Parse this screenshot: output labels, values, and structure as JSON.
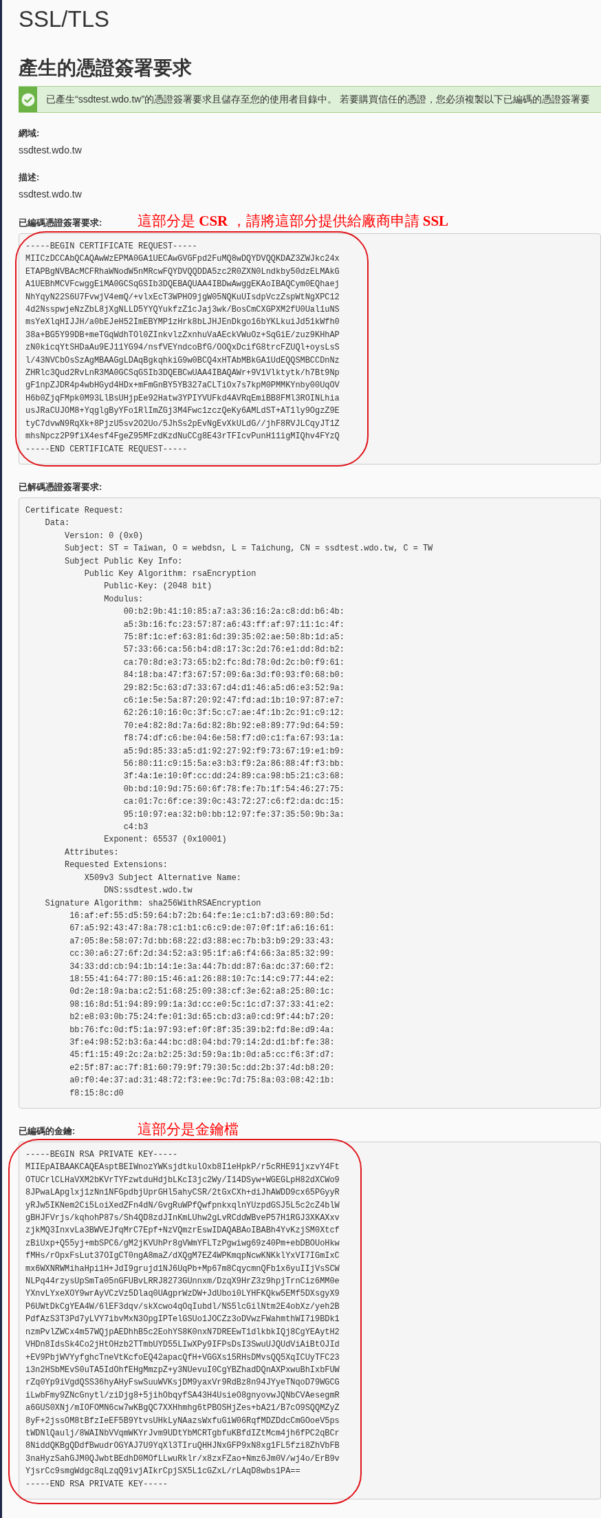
{
  "page_title": "SSL/TLS",
  "heading": "產生的憑證簽署要求",
  "alert": {
    "kind": "success",
    "text": "已產生“ssdtest.wdo.tw”的憑證簽署要求且儲存至您的使用者目錄中。 若要購買信任的憑證，您必須複製以下已編碼的憑證簽署要"
  },
  "fields": [
    {
      "label": "網域:",
      "value": "ssdtest.wdo.tw"
    },
    {
      "label": "描述:",
      "value": "ssdtest.wdo.tw"
    }
  ],
  "blocks": [
    {
      "label": "已編碼憑證簽署要求:",
      "annotation": "這部分是 **CSR** ，請將這部分提供給廠商申請 **SSL**",
      "circled": true,
      "text": "-----BEGIN CERTIFICATE REQUEST-----\nMIICzDCCAbQCAQAwWzEPMA0GA1UECAwGVGFpd2FuMQ8wDQYDVQQKDAZ3ZWJkc24x\nETAPBgNVBAcMCFRhaWNodW5nMRcwFQYDVQQDDA5zc2R0ZXN0Lndkby50dzELMAkG\nA1UEBhMCVFcwggEiMA0GCSqGSIb3DQEBAQUAA4IBDwAwggEKAoIBAQCym0EQhaej\nNhYqyN22S6U7FvwjV4emQ/+vlxEcT3WPHO9jgW05NQKuUIsdpVczZspWtNgXPC12\n4d2NsspwjeNzZbL8jXgNLLD5YYQYukfzZ1cJaj3wk/BosCmCXGPXM2fU0Ual1uNS\nmsYeXlqHIJJH/a0bEJeH52ImEBYMP1zHrk8bLJHJEnDkgo16bYKLkuiJd51kWfh0\n38a+BG5Y99DB+meTGqWdhTOl0ZInkvlzZxnhuVaAEckVWuOz+SqGiE/zuz9KHhAP\nzN0kicqYtSHDaAu9EJ11YG94/nsfVEYndcoBfG/OOQxDcifG8trcFZUQl+oysLsS\nl/43NVCbOsSzAgMBAAGgLDAqBgkqhkiG9w0BCQ4xHTAbMBkGA1UdEQQSMBCCDnNz\nZHRlc3Qud2RvLnR3MA0GCSqGSIb3DQEBCwUAA4IBAQAWr+9V1Vlktytk/h7Bt9Np\ngF1npZJDR4p4wbHGyd4HDx+mFmGnBY5YB327aCLTiOx7s7kpM0PMMKYnby00UqOV\nH6b0ZjqFMpk0M93LlBsUHjpEe92Hatw3YPIYVUFkd4AVRqEmiBB8FMl3ROINLhia\nusJRaCUJOM8+YqglgByYFo1RlImZGj3M4Fwc1zczQeKy6AMLdST+AT1ly9OgzZ9E\ntyC7dvwN9RqXk+8PjzU5sv2O2Uo/5JhSs2pEvNgEvXkULdG//jhF8RVJLCqyJT1Z\nmhsNpcz2P9fiX4esf4FgeZ95MFzdKzdNuCCg8E43rTFIcvPunH11igMIQhv4FYzQ\n-----END CERTIFICATE REQUEST-----"
    },
    {
      "label": "已解碼憑證簽署要求:",
      "circled": false,
      "text": "Certificate Request:\n    Data:\n        Version: 0 (0x0)\n        Subject: ST = Taiwan, O = webdsn, L = Taichung, CN = ssdtest.wdo.tw, C = TW\n        Subject Public Key Info:\n            Public Key Algorithm: rsaEncryption\n                Public-Key: (2048 bit)\n                Modulus:\n                    00:b2:9b:41:10:85:a7:a3:36:16:2a:c8:dd:b6:4b:\n                    a5:3b:16:fc:23:57:87:a6:43:ff:af:97:11:1c:4f:\n                    75:8f:1c:ef:63:81:6d:39:35:02:ae:50:8b:1d:a5:\n                    57:33:66:ca:56:b4:d8:17:3c:2d:76:e1:dd:8d:b2:\n                    ca:70:8d:e3:73:65:b2:fc:8d:78:0d:2c:b0:f9:61:\n                    84:18:ba:47:f3:67:57:09:6a:3d:f0:93:f0:68:b0:\n                    29:82:5c:63:d7:33:67:d4:d1:46:a5:d6:e3:52:9a:\n                    c6:1e:5e:5a:87:20:92:47:fd:ad:1b:10:97:87:e7:\n                    62:26:10:16:0c:3f:5c:c7:ae:4f:1b:2c:91:c9:12:\n                    70:e4:82:8d:7a:6d:82:8b:92:e8:89:77:9d:64:59:\n                    f8:74:df:c6:be:04:6e:58:f7:d0:c1:fa:67:93:1a:\n                    a5:9d:85:33:a5:d1:92:27:92:f9:73:67:19:e1:b9:\n                    56:80:11:c9:15:5a:e3:b3:f9:2a:86:88:4f:f3:bb:\n                    3f:4a:1e:10:0f:cc:dd:24:89:ca:98:b5:21:c3:68:\n                    0b:bd:10:9d:75:60:6f:78:fe:7b:1f:54:46:27:75:\n                    ca:01:7c:6f:ce:39:0c:43:72:27:c6:f2:da:dc:15:\n                    95:10:97:ea:32:b0:bb:12:97:fe:37:35:50:9b:3a:\n                    c4:b3\n                Exponent: 65537 (0x10001)\n        Attributes:\n        Requested Extensions:\n            X509v3 Subject Alternative Name:\n                DNS:ssdtest.wdo.tw\n    Signature Algorithm: sha256WithRSAEncryption\n         16:af:ef:55:d5:59:64:b7:2b:64:fe:1e:c1:b7:d3:69:80:5d:\n         67:a5:92:43:47:8a:78:c1:b1:c6:c9:de:07:0f:1f:a6:16:61:\n         a7:05:8e:58:07:7d:bb:68:22:d3:88:ec:7b:b3:b9:29:33:43:\n         cc:30:a6:27:6f:2d:34:52:a3:95:1f:a6:f4:66:3a:85:32:99:\n         34:33:dd:cb:94:1b:14:1e:3a:44:7b:dd:87:6a:dc:37:60:f2:\n         18:55:41:64:77:80:15:46:a1:26:88:10:7c:14:c9:77:44:e2:\n         0d:2e:18:9a:ba:c2:51:68:25:09:38:cf:3e:62:a8:25:80:1c:\n         98:16:8d:51:94:89:99:1a:3d:cc:e0:5c:1c:d7:37:33:41:e2:\n         b2:e8:03:0b:75:24:fe:01:3d:65:cb:d3:a0:cd:9f:44:b7:20:\n         bb:76:fc:0d:f5:1a:97:93:ef:0f:8f:35:39:b2:fd:8e:d9:4a:\n         3f:e4:98:52:b3:6a:44:bc:d8:04:bd:79:14:2d:d1:bf:fe:38:\n         45:f1:15:49:2c:2a:b2:25:3d:59:9a:1b:0d:a5:cc:f6:3f:d7:\n         e2:5f:87:ac:7f:81:60:79:9f:79:30:5c:dd:2b:37:4d:b8:20:\n         a0:f0:4e:37:ad:31:48:72:f3:ee:9c:7d:75:8a:03:08:42:1b:\n         f8:15:8c:d0"
    },
    {
      "label": "已編碼的金鑰:",
      "annotation": "這部分是金鑰檔",
      "circled": true,
      "text": "-----BEGIN RSA PRIVATE KEY-----\nMIIEpAIBAAKCAQEAsptBEIWnozYWKsjdtkulOxb8I1eHpkP/r5cRHE91jxzvY4Ft\nOTUCrlCLHaVXM2bKVrTYFzwtduHdjbLKcI3jc2Wy/I14DSyw+WGEGLpH82dXCWo9\n8JPwaLApglxj1zNn1NFGpdbjUprGHl5ahyCSR/2tGxCXh+diJhAWDD9cx65PGyyR\nyRJw5IKNem2Ci5LoiXedZFn4dN/GvgRuWPfQwfpnkxqlnYUzpdGSJ5L5c2cZ4blW\ngBHJFVrjs/kqhohP87s/Sh4QD8zdJInKmLUhw2gLvRCddWBveP57H1RGJ3XKAXxv\nzjkMQ3InxvLa3BWVEJfqMrC7Epf+NzVQmzrEswIDAQABAoIBABh4YvKzjSM0Xtcf\nzBiUxp+Q55yj+mbSPC6/gM2jKVUhPr8gVWmYFLTzPgwiwg69z40Pm+ebDBOUoHkw\nfMHs/rOpxFsLut37OIgCT0ngA8maZ/dXQgM7EZ4WPKmqpNcwKNKklYxVI7IGmIxC\nmx6WXNRWMihaHpi1H+JdI9grujd1NJ6UqPb+Mp67m8CqycmnQFb1x6yuIIjVsSCW\nNLPq44rzysUpSmTa05nGFUBvLRRJ8273GUnnxm/DzqX9HrZ3z9hpjTrnCiz6MM0e\nYXnvLYxeXOY9wrAyVCzVz5Dlaq0UAgprWzDW+JdUboi0LYHFKQkw5EMf5DXsgyX9\nP6UWtDkCgYEA4W/6lEF3dqv/skXcwo4qOqIubdl/NS5lcGilNtm2E4obXz/yeh2B\nPdfAzS3T3Pd7yLVY7ibvMxN3OpgIPTelGSUo1JOCZz3oDVwzFWahmthWI7i9BDk1\nnzmPvlZWCx4m57WQjpAEDhhB5c2EohYS8K0nxN7DREEwT1dlkbkIQj8CgYEAytH2\nVHDn8IdsSk4Co2jHtOHzb2TTmbUYD55LIwXPy9IFPsDsI3SwuUJQUdViAiBtOJId\n+EV9PbjWVYyfghcTneVtKcfoEQ42apacQfH+VGGXs15RHsDMvsQQ5XqICUyTFC23\ni3n2HSbMEvS0uTA5IdOhfEHgMmzpZ+y3NUevuI0CgYBZhadDQnAXPxwuBhIxbFUW\nrZq0Yp9iVgdQSS36hyAHyFswSuuWVKsjDM9yaxVr9RdBz8n94JYyeTNqoD79WGCG\niLwbFmy9ZNcGnytl/ziDjg8+5jihObqyfSA43H4UsieO8gnyovwJQNbCVAesegmR\na6GUS0XNj/mIOFOMN6cw7wKBgQC7XXHhmhg6tPBOSHjZes+bA21/B7cO9SQQMZyZ\n8yF+2jssOM8tBfzIeEF5B9YtvsUHkLyNAazsWxfuGiW06RqfMDZDdcCmGOoeV5ps\ntWDNlQaulj/8WAINbVVqmWKYrJvm9UDtYbMCRTgbfuKBfdIZtMcm4jh6fPC2qBCr\n8NiddQKBgQDdfBwudrOGYAJ7U9YqXl3TIruQHHJNxGFP9xN8xg1FL5fzi8ZhVbFB\n3naHyzSahGJM0QJwbtBEdhD0MOfLLwuRklr/x8zxFZao+Nmz6Jm0V/wj4o/ErB9v\nYjsrCc9smgWdgc8qLzqQ9ivjAIkrCpjSX5L1cGZxL/rLAqD8wbs1PA==\n-----END RSA PRIVATE KEY-----"
    }
  ]
}
